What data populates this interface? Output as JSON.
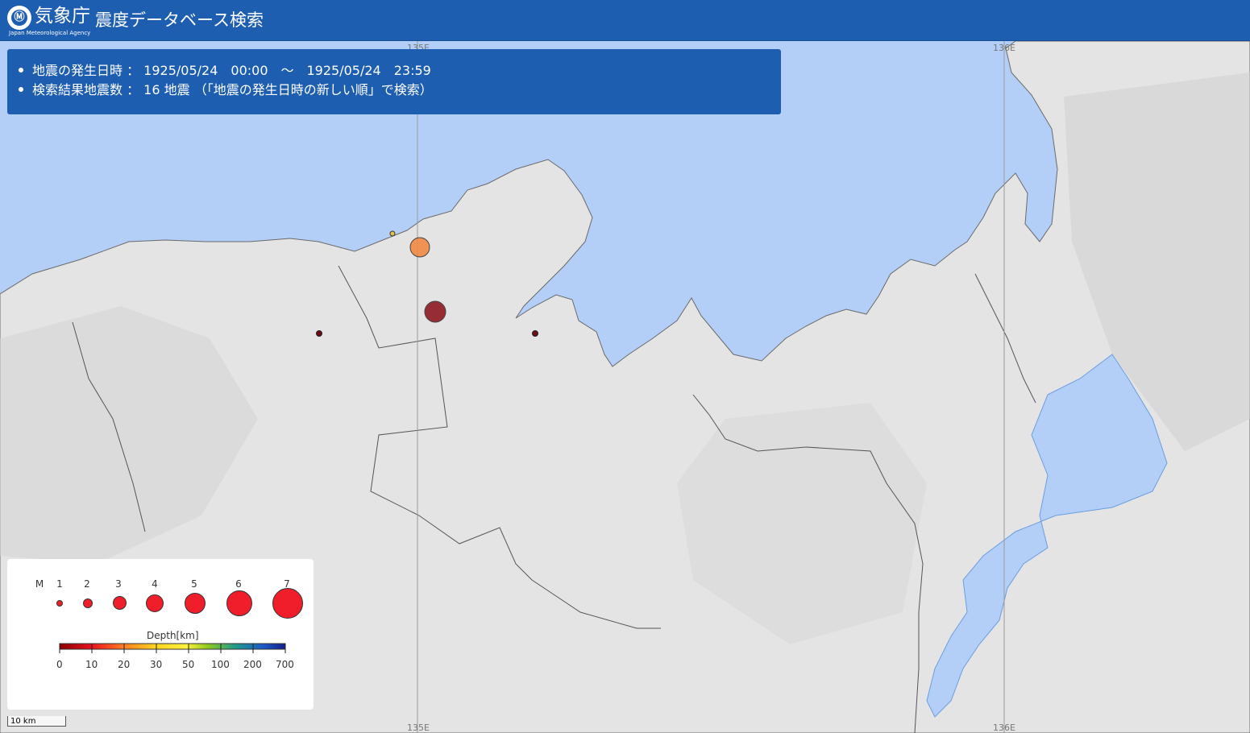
{
  "header": {
    "agency_name": "気象庁",
    "agency_name_en": "Japan Meteorological Agency",
    "logo_glyph": "Ⓜ",
    "title": "震度データベース検索"
  },
  "info": {
    "line1": "地震の発生日時 ： 1925/05/24　00:00　～　1925/05/24　23:59",
    "line2": "検索結果地震数 ： 16 地震 （「地震の発生日時の新しい順」で検索）"
  },
  "map": {
    "grid_labels": {
      "top_left": "135E",
      "top_right": "136E",
      "bottom_left": "135E",
      "bottom_right": "136E"
    },
    "scale": "10 km",
    "colors": {
      "sea": "#b3cff8",
      "land": "#e4e4e4",
      "grid": "#9a9a9a"
    },
    "epicenters": [
      {
        "magnitude_size": 6,
        "depth_color": "#8e1a22"
      },
      {
        "magnitude_size": 5,
        "depth_color": "#f28a45"
      },
      {
        "magnitude_size": 2,
        "depth_color": "#e8c04a"
      },
      {
        "magnitude_size": 1,
        "depth_color": "#6e0a12"
      },
      {
        "magnitude_size": 1,
        "depth_color": "#6e0a12"
      }
    ]
  },
  "legend": {
    "m_label": "M",
    "magnitudes": [
      "1",
      "2",
      "3",
      "4",
      "5",
      "6",
      "7"
    ],
    "depth_label": "Depth[km]",
    "depth_ticks": [
      "0",
      "10",
      "20",
      "30",
      "50",
      "100",
      "200",
      "700"
    ],
    "depth_colors": [
      "#8b0000",
      "#e8101e",
      "#ff7a20",
      "#ffd21e",
      "#fff23c",
      "#8cc81e",
      "#1e9b8c",
      "#1e5ac8",
      "#141e8c"
    ]
  }
}
